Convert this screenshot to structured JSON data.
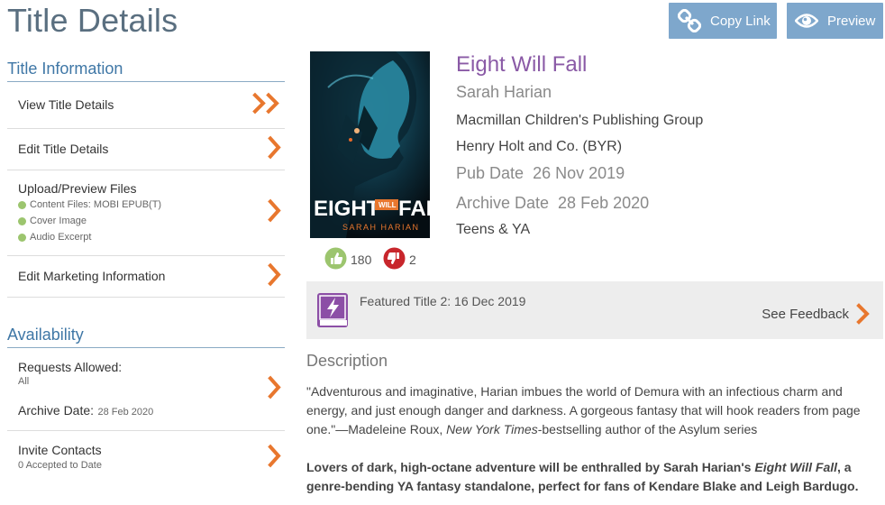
{
  "page": {
    "title": "Title Details"
  },
  "top_buttons": {
    "copy_link": {
      "label": "Copy Link",
      "icon": "link-icon"
    },
    "preview": {
      "label": "Preview",
      "icon": "eye-icon"
    }
  },
  "sidebar": {
    "title_information": {
      "heading": "Title Information",
      "items": [
        {
          "label": "View Title Details",
          "icon": "double-chevron-right-icon"
        },
        {
          "label": "Edit Title Details",
          "icon": "chevron-right-icon"
        },
        {
          "label": "Upload/Preview Files",
          "icon": "chevron-right-icon",
          "files": [
            "Content Files: MOBI EPUB(T)",
            "Cover Image",
            "Audio Excerpt"
          ]
        },
        {
          "label": "Edit Marketing Information",
          "icon": "chevron-right-icon"
        }
      ]
    },
    "availability": {
      "heading": "Availability",
      "requests_label": "Requests Allowed:",
      "requests_value": "All",
      "archive_label": "Archive Date:",
      "archive_value": "28 Feb 2020",
      "invite_label": "Invite Contacts",
      "invite_value": "0 Accepted to Date"
    }
  },
  "book": {
    "title": "Eight Will Fall",
    "author": "Sarah Harian",
    "publisher": "Macmillan Children's Publishing Group",
    "imprint": "Henry Holt and Co. (BYR)",
    "pub_date_label": "Pub Date",
    "pub_date": "26 Nov 2019",
    "archive_date_label": "Archive Date",
    "archive_date": "28 Feb 2020",
    "category": "Teens & YA",
    "cover_title_1": "EIGHT",
    "cover_title_will": "WILL",
    "cover_title_2": "FALL",
    "cover_author": "SARAH HARIAN"
  },
  "votes": {
    "up": "180",
    "down": "2"
  },
  "featured": {
    "text": "Featured Title 2: 16 Dec 2019",
    "see_feedback": "See Feedback"
  },
  "description": {
    "heading": "Description",
    "para1_a": "\"Adventurous and imaginative, Harian imbues the world of Demura with an infectious charm and energy, and just enough danger and darkness. A gorgeous fantasy that will hook readers from page one.\"—Madeleine Roux, ",
    "para1_italic": "New York Times",
    "para1_b": "-bestselling author of the Asylum series",
    "para2_a": "Lovers of dark, high-octane adventure will be enthralled by Sarah Harian's ",
    "para2_italic": "Eight Will Fall",
    "para2_b": ", a genre-bending YA fantasy standalone, perfect for fans of Kendare Blake and Leigh Bardugo."
  },
  "colors": {
    "accent_orange": "#e8772e",
    "button_blue": "#7ea7cc",
    "heading_blue": "#3f77a6",
    "title_purple": "#8a5aa6",
    "featured_purple": "#8c4fa6",
    "green_dot": "#9cc56e",
    "thumbs_up_green": "#9cc56e",
    "thumbs_down_red": "#c8262c"
  }
}
